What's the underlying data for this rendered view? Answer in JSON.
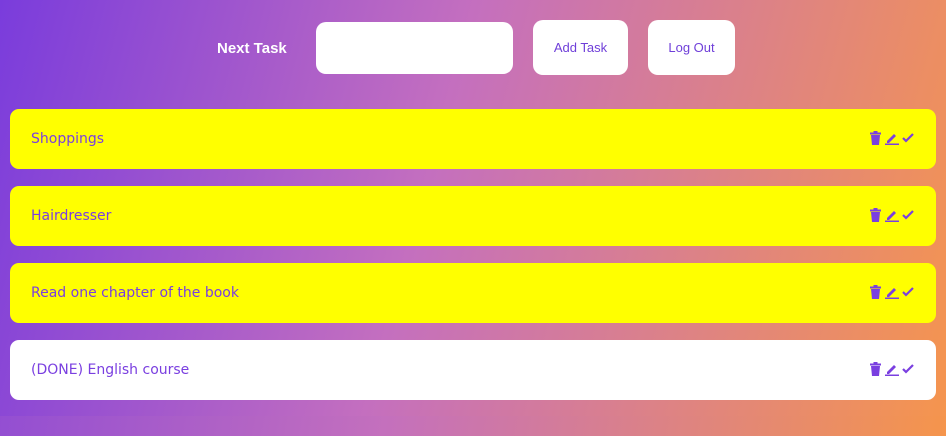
{
  "header": {
    "label": "Next Task",
    "input_value": "",
    "input_placeholder": "",
    "add_label": "Add Task",
    "logout_label": "Log Out"
  },
  "tasks": [
    {
      "text": "Shoppings",
      "done": false
    },
    {
      "text": "Hairdresser",
      "done": false
    },
    {
      "text": "Read one chapter of the book",
      "done": false
    },
    {
      "text": "(DONE) English course",
      "done": true
    }
  ],
  "icons": [
    "trash-icon",
    "pencil-icon",
    "check-icon"
  ],
  "colors": {
    "accent": "#7a3fe0",
    "pending": "#ffff00",
    "done": "#ffffff"
  }
}
